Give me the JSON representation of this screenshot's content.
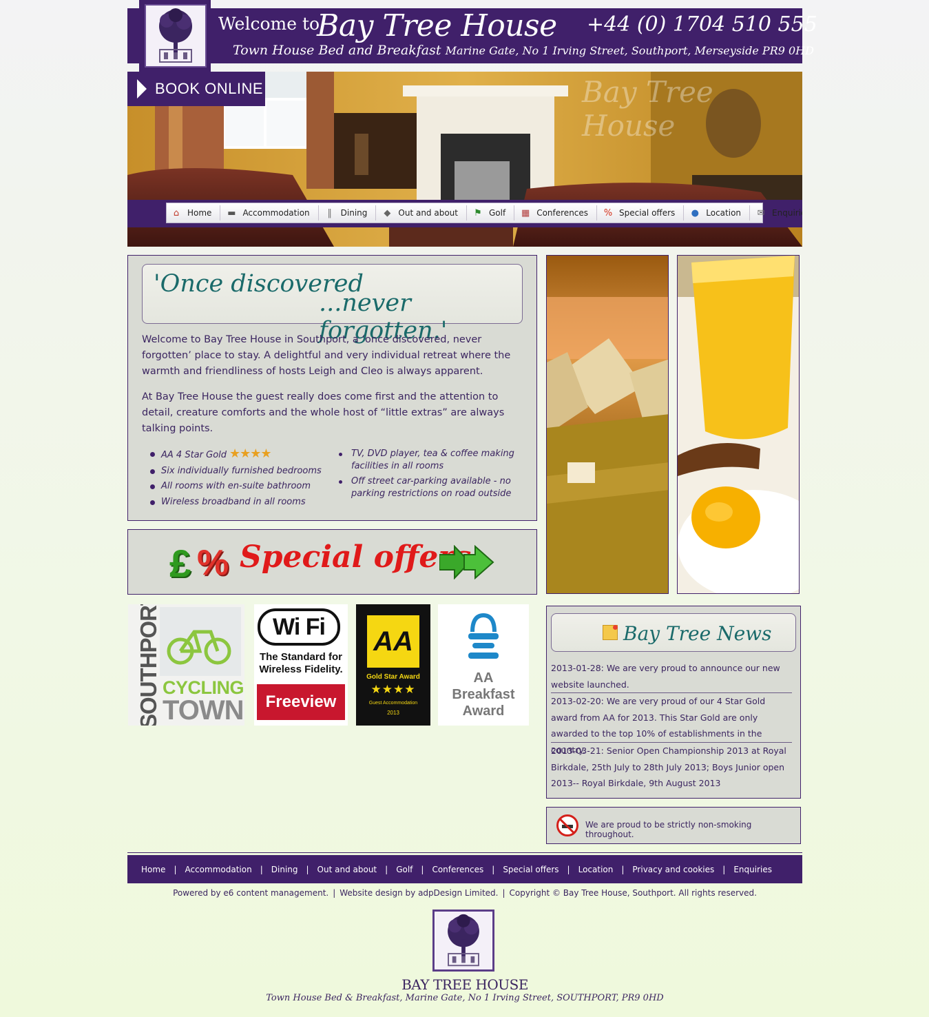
{
  "header": {
    "welcome": "Welcome to",
    "brand": "Bay Tree House",
    "phone": "+44 (0) 1704 510 555",
    "tagline": "Town House Bed and Breakfast",
    "address": "Marine Gate, No 1 Irving Street, Southport, Merseyside PR9 0HD"
  },
  "hero": {
    "watermark": "Bay Tree House",
    "book_label": "BOOK ONLINE"
  },
  "nav": [
    {
      "label": "Home",
      "icon": "home-icon"
    },
    {
      "label": "Accommodation",
      "icon": "bed-icon"
    },
    {
      "label": "Dining",
      "icon": "cutlery-icon"
    },
    {
      "label": "Out and about",
      "icon": "signpost-icon"
    },
    {
      "label": "Golf",
      "icon": "golf-flag-icon"
    },
    {
      "label": "Conferences",
      "icon": "calendar-icon"
    },
    {
      "label": "Special offers",
      "icon": "percent-icon"
    },
    {
      "label": "Location",
      "icon": "pin-icon"
    },
    {
      "label": "Enquiries",
      "icon": "envelope-icon"
    }
  ],
  "intro": {
    "quote_line1": "'Once discovered",
    "quote_line2": "...never forgotten.'",
    "para1": "Welcome to Bay Tree House in Southport, a ‘once discovered, never forgotten’ place to stay. A delightful and very individual retreat where the warmth and friendliness of hosts Leigh and Cleo is always apparent.",
    "para2": "At Bay Tree House the guest really does come first and the attention to detail, creature comforts and the whole host of “little extras” are always talking points.",
    "features_left": [
      "AA 4 Star Gold",
      "Six individually furnished bedrooms",
      "All rooms with en-suite bathroom",
      "Wireless broadband in all rooms"
    ],
    "stars": "★★★★",
    "features_right": [
      "TV, DVD player, tea & coffee making facilities in all rooms",
      "Off street car-parking available - no parking restrictions on road outside"
    ]
  },
  "offers": {
    "pound": "£",
    "percent": "%",
    "text": "Special offers"
  },
  "badges": {
    "cycle_side": "SOUTHPORT",
    "cycle_line1": "CYCLING",
    "cycle_line2": "TOWN",
    "wifi_logo": "Wi Fi",
    "wifi_text": "The Standard for Wireless Fidelity.",
    "freeview": "Freeview",
    "aa_logo": "AA",
    "aa_award": "Gold Star Award",
    "aa_stars": "★★★★",
    "aa_sub": "Guest Accommodation",
    "aa_year": "2013",
    "bfast_aa": "AA",
    "bfast_l1": "Breakfast",
    "bfast_l2": "Award"
  },
  "news": {
    "title": "Bay Tree News",
    "items": [
      "2013-01-28: We are very proud to announce our new website launched.",
      "2013-02-20: We are very proud of our 4 Star Gold award from AA for 2013. This Star Gold are only awarded to the top 10% of establishments in the country.",
      "2013-03-21: Senior Open Championship 2013 at Royal Birkdale, 25th July to 28th July 2013; Boys Junior open 2013-- Royal Birkdale, 9th August 2013"
    ]
  },
  "nosmoke": "We are proud to be strictly non-smoking throughout.",
  "footer": {
    "nav": [
      "Home",
      "Accommodation",
      "Dining",
      "Out and about",
      "Golf",
      "Conferences",
      "Special offers",
      "Location",
      "Privacy and cookies",
      "Enquiries"
    ],
    "sep": "|",
    "powered": "Powered by e6 content management.",
    "design": "Website design by adpDesign Limited.",
    "copyright": "Copyright © Bay Tree House, Southport. All rights reserved.",
    "logo_name": "BAY TREE HOUSE",
    "logo_addr": "Town House Bed & Breakfast, Marine Gate, No 1  Irving Street, SOUTHPORT, PR9 0HD"
  },
  "colors": {
    "brand_purple": "#40206a",
    "panel": "#d9dbd4",
    "teal": "#1a6a6a",
    "offer_red": "#e01a1a"
  }
}
